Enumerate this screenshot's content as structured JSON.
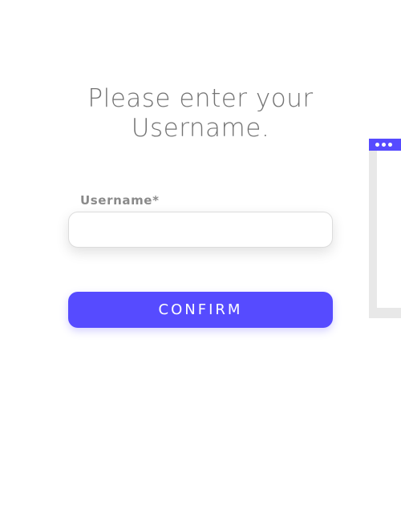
{
  "heading": {
    "line1": "Please enter your",
    "line2": "Username."
  },
  "form": {
    "username_label": "Username*",
    "username_value": "",
    "username_placeholder": "",
    "confirm_label": "CONFIRM"
  },
  "colors": {
    "accent": "#564bff",
    "heading_text": "#737373",
    "label_text": "#8a8a8a",
    "peek_frame": "#e8e8e8"
  },
  "icons": {
    "window_controls": "three-dots-icon"
  }
}
